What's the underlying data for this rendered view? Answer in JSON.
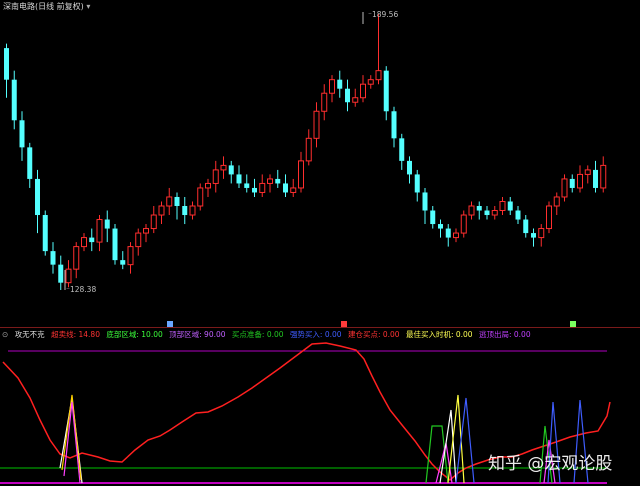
{
  "header": {
    "title": "深南电路(日线 前复权)"
  },
  "price": {
    "high_label": "189.56",
    "low_label": "128.38"
  },
  "markers": {
    "m1_color": "#6aa7ff",
    "m2_color": "#ff3b3b",
    "m3_color": "#7cff60"
  },
  "indicator": {
    "name": "攻无不克",
    "items": [
      {
        "label": "超卖线: 14.80",
        "color": "#ff3333"
      },
      {
        "label": "底部区域: 10.00",
        "color": "#3cff3c"
      },
      {
        "label": "顶部区域: 90.00",
        "color": "#c060ff"
      },
      {
        "label": "买点准备: 0.00",
        "color": "#22c822"
      },
      {
        "label": "强势买入: 0.00",
        "color": "#3f5dff"
      },
      {
        "label": "建仓买点: 0.00",
        "color": "#ff3333"
      },
      {
        "label": "最佳买入时机: 0.00",
        "color": "#ffff55"
      },
      {
        "label": "逃顶出局: 0.00",
        "color": "#c040ff"
      }
    ]
  },
  "watermark": "知乎 @宏观论股",
  "colors": {
    "up": "#ff2e2e",
    "down": "#54ffff",
    "curve": "#ff2020",
    "top_line": "#b000c0",
    "bottom_line": "#00c000",
    "base_line": "#ff00ff"
  },
  "chart_data": {
    "type": "candlestick",
    "high": 189.56,
    "low": 128.38,
    "candles": [
      [
        182,
        175,
        183,
        171
      ],
      [
        175,
        166,
        177,
        164
      ],
      [
        166,
        160,
        168,
        157
      ],
      [
        160,
        153,
        161,
        151
      ],
      [
        153,
        145,
        155,
        141
      ],
      [
        145,
        137,
        146,
        136
      ],
      [
        137,
        134,
        139,
        132
      ],
      [
        134,
        130,
        136,
        128.38
      ],
      [
        130,
        133,
        135,
        129
      ],
      [
        133,
        138,
        139,
        131
      ],
      [
        138,
        140,
        141,
        137
      ],
      [
        140,
        139,
        142,
        137
      ],
      [
        139,
        144,
        145,
        137
      ],
      [
        144,
        142,
        146,
        139
      ],
      [
        142,
        135,
        143,
        134
      ],
      [
        135,
        134,
        137,
        133
      ],
      [
        134,
        138,
        139,
        132
      ],
      [
        138,
        141,
        142,
        136
      ],
      [
        141,
        142,
        143,
        139
      ],
      [
        142,
        145,
        147,
        141
      ],
      [
        145,
        147,
        148,
        143
      ],
      [
        147,
        149,
        151,
        145
      ],
      [
        149,
        147,
        150,
        144
      ],
      [
        147,
        145,
        149,
        143
      ],
      [
        145,
        147,
        148,
        144
      ],
      [
        147,
        151,
        152,
        146
      ],
      [
        151,
        152,
        153,
        149
      ],
      [
        152,
        155,
        157,
        150
      ],
      [
        155,
        156,
        158,
        153
      ],
      [
        156,
        154,
        157,
        152
      ],
      [
        154,
        152,
        156,
        151
      ],
      [
        152,
        151,
        154,
        150
      ],
      [
        151,
        150,
        153,
        149
      ],
      [
        150,
        152,
        154,
        149
      ],
      [
        152,
        153,
        154,
        150
      ],
      [
        153,
        152,
        155,
        151
      ],
      [
        152,
        150,
        154,
        149
      ],
      [
        150,
        151,
        153,
        149
      ],
      [
        151,
        157,
        159,
        150
      ],
      [
        157,
        162,
        164,
        156
      ],
      [
        162,
        168,
        170,
        160
      ],
      [
        168,
        172,
        174,
        166
      ],
      [
        172,
        175,
        176,
        170
      ],
      [
        175,
        173,
        177,
        171
      ],
      [
        173,
        170,
        175,
        168
      ],
      [
        170,
        171,
        173,
        169
      ],
      [
        171,
        174,
        176,
        170
      ],
      [
        174,
        175,
        176,
        173
      ],
      [
        175,
        177,
        189.56,
        174
      ],
      [
        177,
        168,
        178,
        166
      ],
      [
        168,
        162,
        169,
        160
      ],
      [
        162,
        157,
        163,
        155
      ],
      [
        157,
        154,
        158,
        152
      ],
      [
        154,
        150,
        155,
        148
      ],
      [
        150,
        146,
        151,
        143
      ],
      [
        146,
        143,
        147,
        142
      ],
      [
        143,
        142,
        144,
        140
      ],
      [
        142,
        140,
        143,
        138
      ],
      [
        140,
        141,
        142,
        139
      ],
      [
        141,
        145,
        146,
        140
      ],
      [
        145,
        147,
        148,
        144
      ],
      [
        147,
        146,
        148,
        144
      ],
      [
        146,
        145,
        147,
        144
      ],
      [
        145,
        146,
        147,
        144
      ],
      [
        146,
        148,
        149,
        145
      ],
      [
        148,
        146,
        149,
        145
      ],
      [
        146,
        144,
        147,
        143
      ],
      [
        144,
        141,
        145,
        140
      ],
      [
        141,
        140,
        142,
        138
      ],
      [
        140,
        142,
        143,
        138
      ],
      [
        142,
        147,
        148,
        141
      ],
      [
        147,
        149,
        150,
        145
      ],
      [
        149,
        153,
        154,
        148
      ],
      [
        153,
        151,
        154,
        150
      ],
      [
        151,
        154,
        156,
        150
      ],
      [
        154,
        155,
        156,
        152
      ],
      [
        155,
        151,
        157,
        150
      ],
      [
        151,
        156,
        158,
        150
      ]
    ]
  }
}
